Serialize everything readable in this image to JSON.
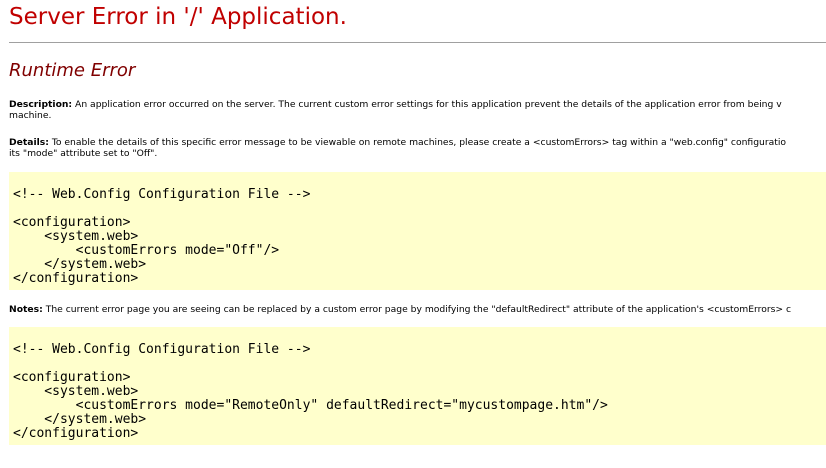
{
  "page": {
    "title": "Server Error in '/' Application.",
    "subtitle": "Runtime Error"
  },
  "description": {
    "label": "Description:",
    "text_line1": "An application error occurred on the server. The current custom error settings for this application prevent the details of the application error from being v",
    "text_line2": "machine."
  },
  "details": {
    "label": "Details:",
    "text_line1": "To enable the details of this specific error message to be viewable on remote machines, please create a <customErrors> tag within a \"web.config\" configuratio",
    "text_line2": "its \"mode\" attribute set to \"Off\"."
  },
  "code_block_1": {
    "lines": [
      "<!-- Web.Config Configuration File -->",
      "",
      "<configuration>",
      "    <system.web>",
      "        <customErrors mode=\"Off\"/>",
      "    </system.web>",
      "</configuration>"
    ]
  },
  "notes": {
    "label": "Notes:",
    "text_line1": "The current error page you are seeing can be replaced by a custom error page by modifying the \"defaultRedirect\" attribute of the application's <customErrors> c"
  },
  "code_block_2": {
    "lines": [
      "<!-- Web.Config Configuration File -->",
      "",
      "<configuration>",
      "    <system.web>",
      "        <customErrors mode=\"RemoteOnly\" defaultRedirect=\"mycustompage.htm\"/>",
      "    </system.web>",
      "</configuration>"
    ]
  },
  "colors": {
    "title": "#c00000",
    "subtitle": "#800000",
    "code_background": "#ffffcc",
    "divider": "#a0a0a0"
  }
}
